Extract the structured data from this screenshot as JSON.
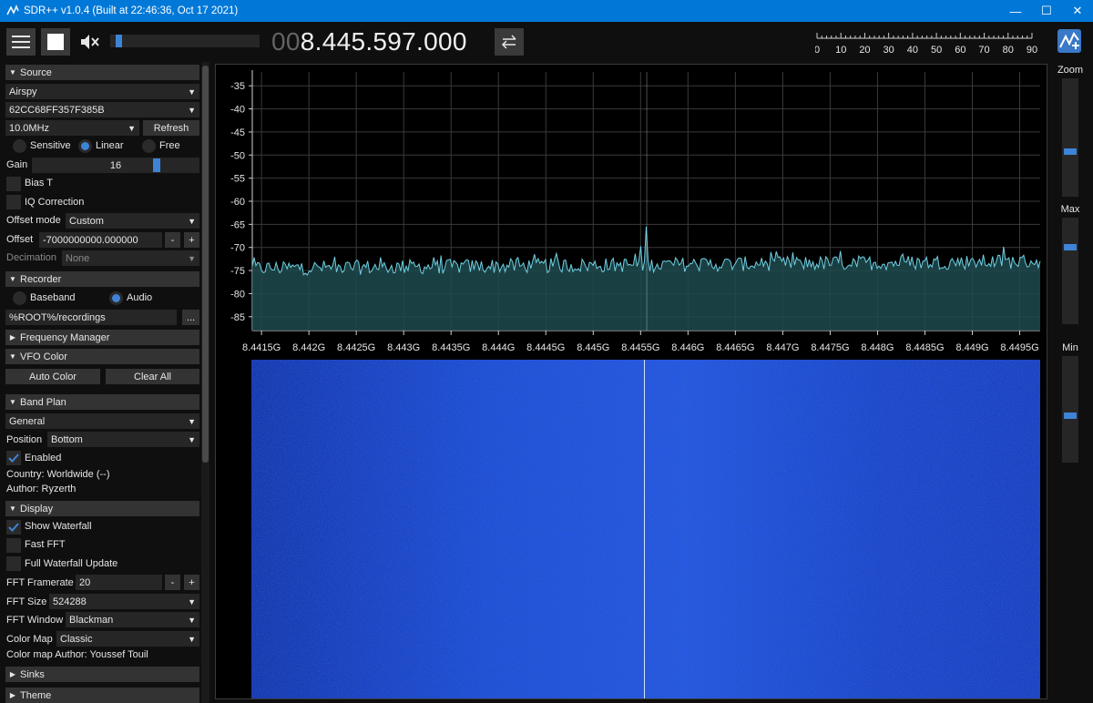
{
  "window": {
    "title": "SDR++ v1.0.4 (Built at 22:46:36, Oct 17 2021)",
    "minimize": "—",
    "maximize": "☐",
    "close": "✕"
  },
  "toolbar": {
    "volume_level": 0.04,
    "freq_dim": "00",
    "freq_lit": "8.445.597.000",
    "snr_ticks": [
      "0",
      "10",
      "20",
      "30",
      "40",
      "50",
      "60",
      "70",
      "80",
      "90"
    ]
  },
  "sidebar": {
    "source": {
      "header": "Source",
      "device": "Airspy",
      "serial": "62CC68FF357F385B",
      "samplerate": "10.0MHz",
      "refresh": "Refresh",
      "gain_modes": [
        "Sensitive",
        "Linear",
        "Free"
      ],
      "gain_mode_selected": "Linear",
      "gain_label": "Gain",
      "gain_value": "16",
      "bias_t": "Bias T",
      "iq_correction": "IQ Correction",
      "offset_mode_label": "Offset mode",
      "offset_mode": "Custom",
      "offset_label": "Offset",
      "offset_value": "-7000000000.000000",
      "decimation_label": "Decimation",
      "decimation": "None",
      "minus": "-",
      "plus": "+"
    },
    "recorder": {
      "header": "Recorder",
      "baseband": "Baseband",
      "audio": "Audio",
      "path": "%ROOT%/recordings",
      "browse": "..."
    },
    "frequency_manager": {
      "header": "Frequency Manager"
    },
    "vfo_color": {
      "header": "VFO Color",
      "auto": "Auto Color",
      "clear": "Clear All"
    },
    "band_plan": {
      "header": "Band Plan",
      "plan": "General",
      "position_label": "Position",
      "position": "Bottom",
      "enabled": "Enabled",
      "country": "Country: Worldwide (--)",
      "author": "Author: Ryzerth"
    },
    "display": {
      "header": "Display",
      "show_waterfall": "Show Waterfall",
      "fast_fft": "Fast FFT",
      "full_waterfall": "Full Waterfall Update",
      "framerate_label": "FFT Framerate",
      "framerate": "20",
      "size_label": "FFT Size",
      "size": "524288",
      "window_label": "FFT Window",
      "window": "Blackman",
      "colormap_label": "Color Map",
      "colormap": "Classic",
      "colormap_author": "Color map Author: Youssef Touil"
    },
    "sinks": {
      "header": "Sinks"
    },
    "theme": {
      "header": "Theme"
    }
  },
  "right": {
    "zoom": "Zoom",
    "max": "Max",
    "min": "Min",
    "zoom_level": 0.37,
    "max_level": 0.74,
    "min_level": 0.44
  },
  "chart_data": {
    "type": "line",
    "xlabel": "",
    "ylabel": "",
    "y_ticks": [
      "-35",
      "-40",
      "-45",
      "-50",
      "-55",
      "-60",
      "-65",
      "-70",
      "-75",
      "-80",
      "-85"
    ],
    "x_ticks": [
      "8.4415G",
      "8.442G",
      "8.4425G",
      "8.443G",
      "8.4435G",
      "8.444G",
      "8.4445G",
      "8.445G",
      "8.4455G",
      "8.446G",
      "8.4465G",
      "8.447G",
      "8.4475G",
      "8.448G",
      "8.4485G",
      "8.449G",
      "8.4495G"
    ],
    "x_range_ghz": [
      8.441403,
      8.449716
    ],
    "ylim": [
      -88,
      -32
    ],
    "noise_floor_db": -74.5,
    "noise_floor_right_db": -73.0,
    "spike_freq_ghz": 8.445565,
    "spike_db": -65.5,
    "grid": true
  }
}
